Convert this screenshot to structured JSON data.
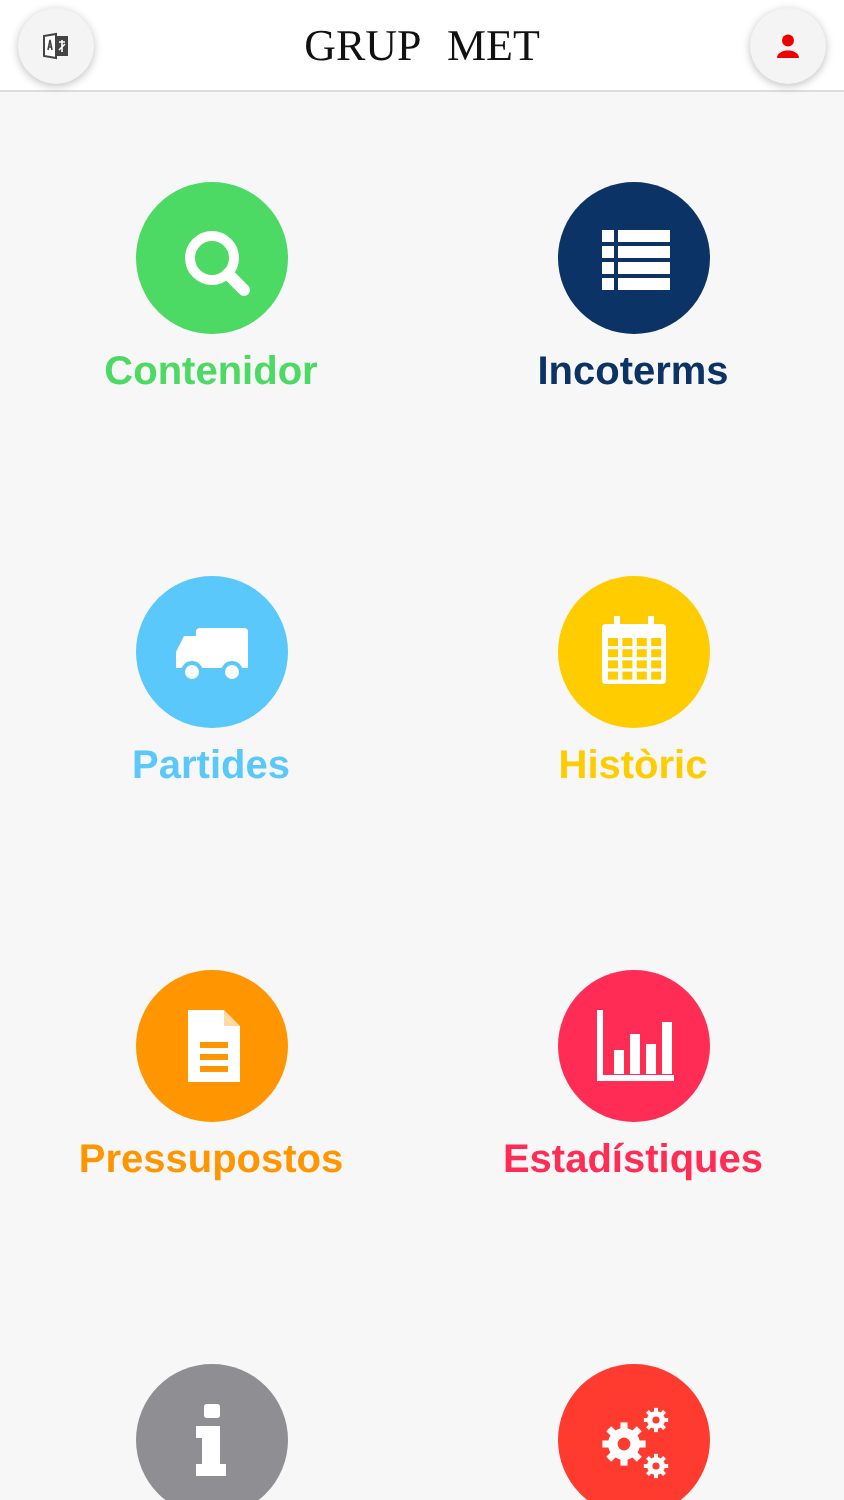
{
  "header": {
    "title": "GRUP MET"
  },
  "tiles": [
    {
      "kind": "search",
      "label": "Contenidor",
      "color": "#4cd964"
    },
    {
      "kind": "list",
      "label": "Incoterms",
      "color": "#0b3366"
    },
    {
      "kind": "truck",
      "label": "Partides",
      "color": "#5ac8fa"
    },
    {
      "kind": "calendar",
      "label": "Històric",
      "color": "#ffcc00"
    },
    {
      "kind": "document",
      "label": "Pressupostos",
      "color": "#ff9500"
    },
    {
      "kind": "chart",
      "label": "Estadístiques",
      "color": "#ff2d55"
    },
    {
      "kind": "info",
      "color": "#8e8e93"
    },
    {
      "kind": "gears",
      "color": "#ff3b30"
    }
  ]
}
